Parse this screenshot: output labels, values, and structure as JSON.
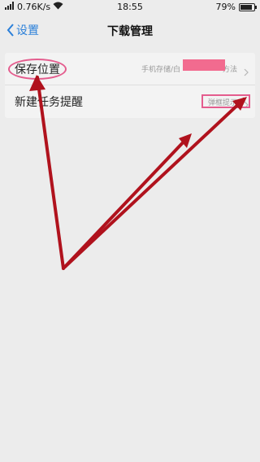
{
  "status_bar": {
    "network_speed": "0.76K/s",
    "time": "18:55",
    "battery_percent": "79%",
    "battery_level": 0.79,
    "wifi_icon": "wifi-icon",
    "signal_icon": "cellular-signal-icon"
  },
  "nav": {
    "back_label": "设置",
    "title": "下载管理",
    "back_icon": "chevron-left-icon"
  },
  "settings": {
    "rows": [
      {
        "label": "保存位置",
        "value": "手机存储/白",
        "value_suffix": "方法"
      },
      {
        "label": "新建任务提醒",
        "value": "弹框提示"
      }
    ]
  },
  "colors": {
    "accent": "#2a7fd9",
    "annotation_red": "#b0121d",
    "annotation_pink": "#e45d8e",
    "background": "#ececec"
  }
}
